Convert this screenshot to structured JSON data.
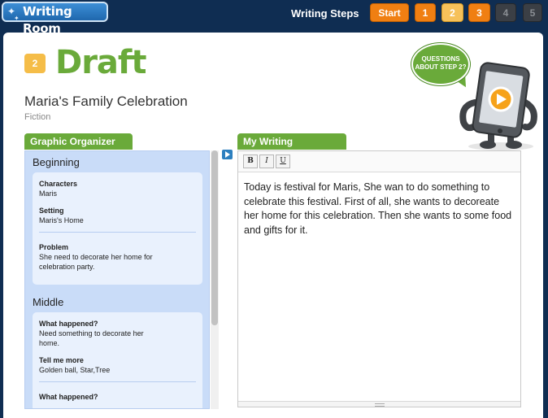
{
  "app": {
    "home_label": "Writing Room"
  },
  "steps": {
    "label": "Writing Steps",
    "start": "Start",
    "items": [
      "1",
      "2",
      "3",
      "4",
      "5"
    ],
    "current": "2"
  },
  "header": {
    "step_number": "2",
    "stage_title": "Draft",
    "story_title": "Maria's Family Celebration",
    "genre": "Fiction",
    "help_bubble": [
      "QUESTIONS",
      "ABOUT STEP 2?"
    ]
  },
  "organizer": {
    "tab_label": "Graphic Organizer",
    "beginning": {
      "heading": "Beginning",
      "characters_label": "Characters",
      "characters_value": "Maris",
      "setting_label": "Setting",
      "setting_value": "Maris's Home",
      "problem_label": "Problem",
      "problem_value": "She need to decorate her home for celebration party."
    },
    "middle": {
      "heading": "Middle",
      "what1_label": "What happened?",
      "what1_value": "Need something to decorate her home.",
      "tell_label": "Tell me more",
      "tell_value": "Golden ball, Star,Tree",
      "what2_label": "What happened?"
    }
  },
  "writing": {
    "tab_label": "My Writing",
    "bold": "B",
    "italic": "I",
    "underline": "U",
    "text": "Today is festival for Maris, She wan to do something to celebrate this festival. First of all, she wants to decoreate her home for this celebration. Then she wants to some food and gifts for it."
  },
  "colors": {
    "navy_bg": "#0f2d52",
    "accent_green": "#6aaa3a",
    "step_orange": "#f07f12",
    "step_current": "#f6c15a",
    "organizer_blue": "#c9dcf8"
  }
}
